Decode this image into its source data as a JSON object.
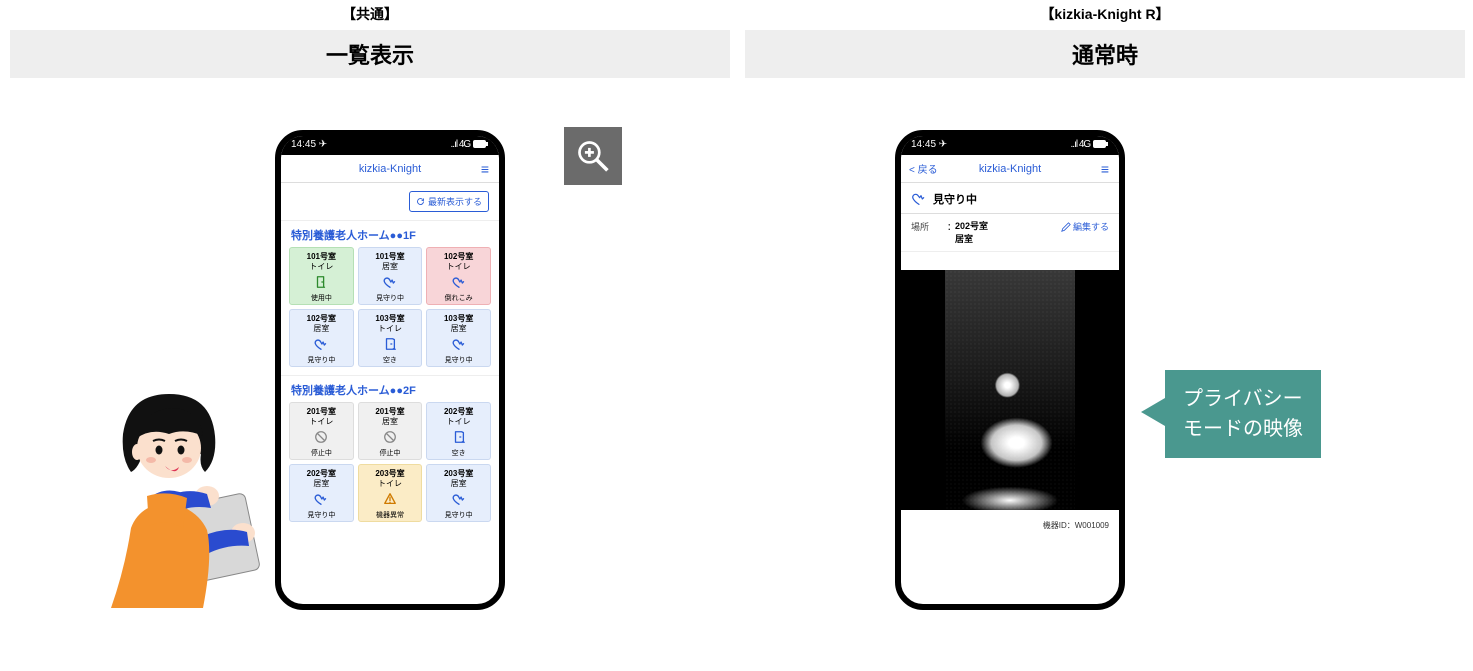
{
  "left": {
    "bracket": "【共通】",
    "title": "一覧表示"
  },
  "right": {
    "bracket": "【kizkia-Knight R】",
    "title": "通常時"
  },
  "status": {
    "time": "14:45 ✈",
    "signal": "..ıl 4G",
    "battery": "batt"
  },
  "app": {
    "name": "kizkia-Knight",
    "back": "< 戻る",
    "menu": "≡",
    "refresh": "最新表示する"
  },
  "floors": [
    {
      "name": "特別養護老人ホーム●●1F",
      "tiles": [
        {
          "room": "101号室",
          "type": "トイレ",
          "status": "使用中",
          "style": "green",
          "icon": "door"
        },
        {
          "room": "101号室",
          "type": "居室",
          "status": "見守り中",
          "style": "blue",
          "icon": "heart"
        },
        {
          "room": "102号室",
          "type": "トイレ",
          "status": "倒れこみ",
          "style": "pink",
          "icon": "heart"
        },
        {
          "room": "102号室",
          "type": "居室",
          "status": "見守り中",
          "style": "blue",
          "icon": "heart"
        },
        {
          "room": "103号室",
          "type": "トイレ",
          "status": "空き",
          "style": "blue",
          "icon": "door-open"
        },
        {
          "room": "103号室",
          "type": "居室",
          "status": "見守り中",
          "style": "blue",
          "icon": "heart"
        }
      ]
    },
    {
      "name": "特別養護老人ホーム●●2F",
      "tiles": [
        {
          "room": "201号室",
          "type": "トイレ",
          "status": "停止中",
          "style": "gray",
          "icon": "stop"
        },
        {
          "room": "201号室",
          "type": "居室",
          "status": "停止中",
          "style": "gray",
          "icon": "stop"
        },
        {
          "room": "202号室",
          "type": "トイレ",
          "status": "空き",
          "style": "blue",
          "icon": "door-open"
        },
        {
          "room": "202号室",
          "type": "居室",
          "status": "見守り中",
          "style": "blue",
          "icon": "heart"
        },
        {
          "room": "203号室",
          "type": "トイレ",
          "status": "機器異常",
          "style": "yellow",
          "icon": "alert"
        },
        {
          "room": "203号室",
          "type": "居室",
          "status": "見守り中",
          "style": "blue",
          "icon": "heart"
        }
      ]
    }
  ],
  "detail": {
    "status": "見守り中",
    "place_label": "場所",
    "place_value1": "202号室",
    "place_value2": "居室",
    "edit": "編集する",
    "device_label": "機器ID：",
    "device_id": "W001009"
  },
  "callout": {
    "line1": "プライバシー",
    "line2": "モードの映像"
  }
}
